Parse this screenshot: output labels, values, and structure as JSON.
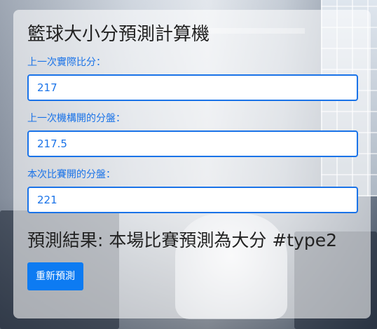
{
  "app": {
    "title": "籃球大小分預測計算機"
  },
  "form": {
    "last_actual_label": "上一次實際比分：",
    "last_actual_value": "217",
    "last_line_label": "上一次機構開的分盤：",
    "last_line_value": "217.5",
    "current_line_label": "本次比賽開的分盤：",
    "current_line_value": "221"
  },
  "result": {
    "text": "預測結果: 本場比賽預測為大分 #type2"
  },
  "actions": {
    "reset_label": "重新預測"
  },
  "colors": {
    "accent": "#1a73e8",
    "button": "#0d7bf2",
    "card_bg": "rgba(255,255,255,0.58)"
  }
}
